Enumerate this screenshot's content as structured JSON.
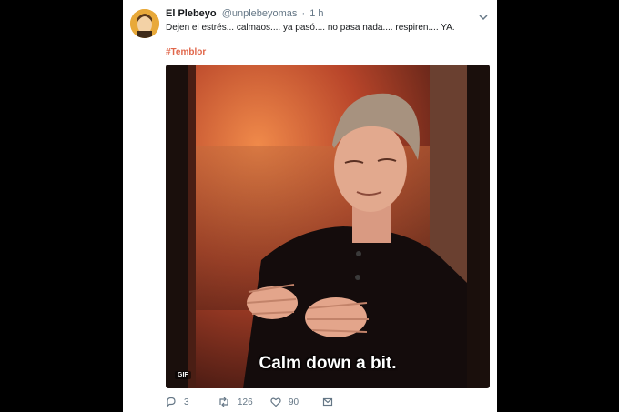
{
  "colors": {
    "hashtag": "#e0664a",
    "secondary_text": "#657786",
    "primary_text": "#14171a",
    "background": "#000000",
    "card": "#ffffff"
  },
  "tweet": {
    "display_name": "El Plebeyo",
    "handle": "@unplebeyomas",
    "separator": "·",
    "time": "1 h",
    "text": "Dejen el estrés... calmaos.... ya pasó.... no pasa nada.... respiren.... YA.",
    "hashtag": "#Temblor",
    "media": {
      "caption": "Calm down a bit.",
      "badge": "GIF"
    },
    "actions": {
      "reply_count": "3",
      "retweet_count": "126",
      "like_count": "90"
    },
    "icons": [
      "caret-down-icon",
      "reply-icon",
      "retweet-icon",
      "heart-icon",
      "message-icon"
    ]
  }
}
